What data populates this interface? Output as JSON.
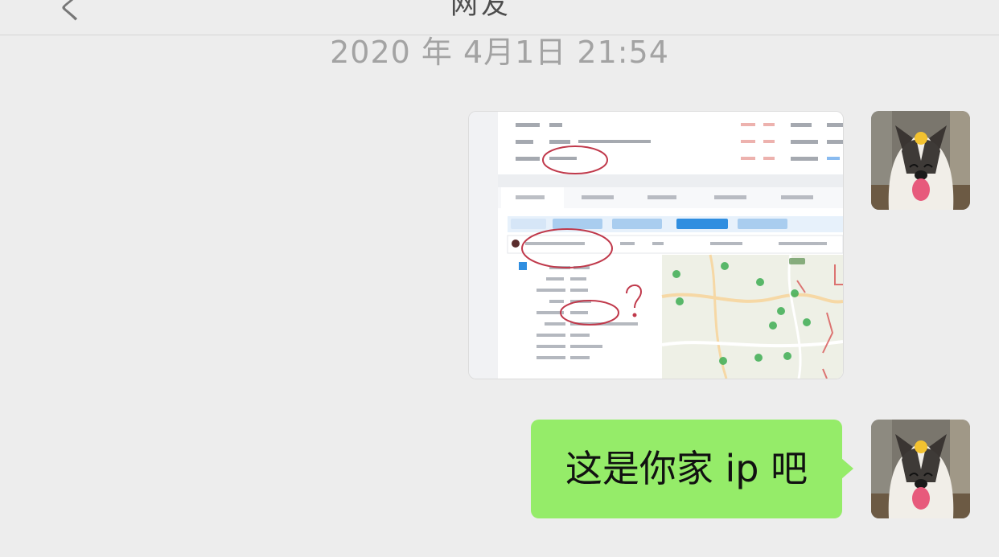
{
  "header": {
    "back_glyph": "く",
    "title_fragment": "网友"
  },
  "chat": {
    "timestamp": "2020 年 4月1日 21:54",
    "messages": [
      {
        "type": "image",
        "sender": "self",
        "avatar": "husky-dog-avatar",
        "description_icon": "screenshot-thumbnail",
        "highlight_color": "#c0394b"
      },
      {
        "type": "text",
        "sender": "self",
        "avatar": "husky-dog-avatar",
        "text": "这是你家 ip 吧"
      }
    ]
  },
  "colors": {
    "background": "#ededed",
    "self_bubble": "#95ec69",
    "timestamp_text": "#a3a3a3",
    "map_accent": "#3fae54",
    "annotation_red": "#c0394b"
  }
}
